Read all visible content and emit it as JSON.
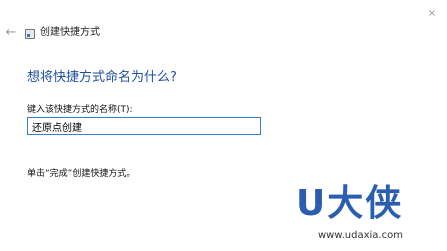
{
  "window": {
    "title": "创建快捷方式",
    "back_glyph": "←",
    "close_glyph": "×",
    "back_icon": "back-arrow-icon",
    "app_icon": "shortcut-icon"
  },
  "main": {
    "heading": "想将快捷方式命名为什么?",
    "field_label": "键入该快捷方式的名称(T):",
    "field_value": "还原点创建",
    "hint": "单击“完成”创建快捷方式。"
  },
  "watermark": {
    "logo_text": "U大侠",
    "url": "www.udaxia.com",
    "color": "#2b5db0"
  },
  "colors": {
    "heading": "#1f4f9e",
    "input_border": "#3b7ad9"
  }
}
